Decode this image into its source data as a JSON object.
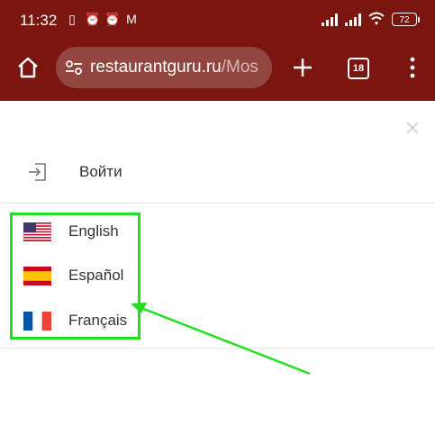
{
  "status_bar": {
    "time": "11:32",
    "battery": "72",
    "icons": [
      "notification-icon",
      "alarm-icon",
      "alarm-icon",
      "gmail-icon"
    ]
  },
  "browser": {
    "url_host": "restaurantguru.ru",
    "url_path": "/Mos",
    "tab_count": "18",
    "toolbar_color": "#7a1510"
  },
  "menu": {
    "login_label": "Войти",
    "languages": [
      {
        "label": "English",
        "flag": "us-flag-icon"
      },
      {
        "label": "Español",
        "flag": "spain-flag-icon"
      },
      {
        "label": "Français",
        "flag": "france-flag-icon"
      }
    ]
  },
  "annotation": {
    "highlight_color": "#22e01f"
  }
}
